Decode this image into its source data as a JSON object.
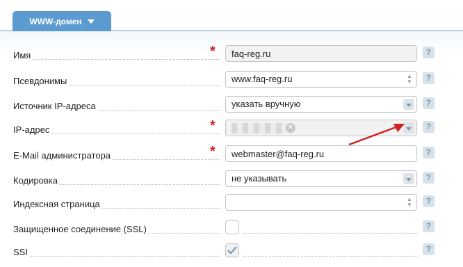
{
  "tab": {
    "label": "WWW-домен"
  },
  "colors": {
    "accent": "#5b9bd0",
    "required": "#d42020",
    "annotation_arrow": "#d42020"
  },
  "form": {
    "name": {
      "label": "Имя",
      "required": true,
      "value": "faq-reg.ru"
    },
    "aliases": {
      "label": "Псевдонимы",
      "value": "www.faq-reg.ru"
    },
    "ip_source": {
      "label": "Источник IP-адреса",
      "value": "указать вручную"
    },
    "ip_address": {
      "label": "IP-адрес",
      "required": true,
      "value": ""
    },
    "admin_email": {
      "label": "E-Mail администратора",
      "required": true,
      "value": "webmaster@faq-reg.ru"
    },
    "encoding": {
      "label": "Кодировка",
      "value": "не указывать"
    },
    "index_page": {
      "label": "Индексная страница",
      "value": ""
    },
    "ssl": {
      "label": "Защищенное соединение (SSL)",
      "checked": false
    },
    "ssi": {
      "label": "SSI",
      "checked": true
    }
  },
  "help_icon": {
    "glyph": "?"
  }
}
